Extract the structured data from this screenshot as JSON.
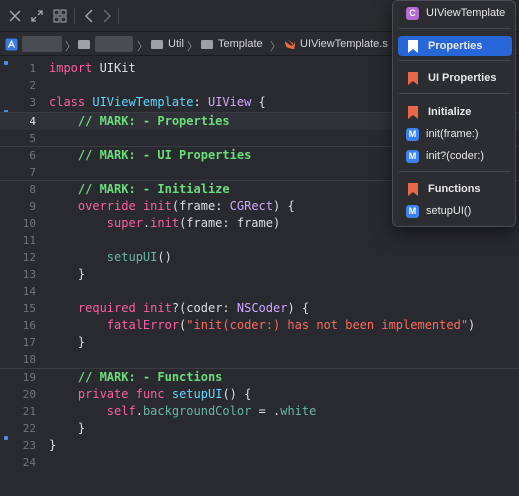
{
  "toolbar": {
    "icons": [
      "close-icon",
      "expand-icon",
      "grid-icon",
      "back-icon",
      "forward-icon"
    ]
  },
  "jumpbar": {
    "crumb_3": "Util",
    "crumb_4": "Template",
    "crumb_5": "UIViewTemplate.s"
  },
  "editor": {
    "line_numbers": [
      "1",
      "2",
      "3",
      "4",
      "5",
      "6",
      "7",
      "8",
      "9",
      "10",
      "11",
      "12",
      "13",
      "14",
      "15",
      "16",
      "17",
      "18",
      "19",
      "20",
      "21",
      "22",
      "23",
      "24"
    ],
    "current_line": "4",
    "mark_properties": "// MARK: - Properties",
    "mark_ui_properties": "// MARK: - UI Properties",
    "mark_initialize": "// MARK: - Initialize",
    "mark_functions": "// MARK: - Functions",
    "fatal_error_message": "\"init(coder:) has not been implemented\"",
    "class_name": "UIViewTemplate",
    "superclass": "UIView",
    "colors": {
      "keyword": "#fc5fa3",
      "mark": "#6bdc7a",
      "string": "#fc6a5d",
      "type": "#d0a8ff"
    }
  },
  "popup": {
    "header": "UIViewTemplate",
    "items": [
      {
        "label": "Properties",
        "kind": "mark",
        "selected": true
      },
      {
        "label": "UI Properties",
        "kind": "mark"
      },
      {
        "label": "Initialize",
        "kind": "mark"
      },
      {
        "label": "init(frame:)",
        "kind": "method"
      },
      {
        "label": "init?(coder:)",
        "kind": "method"
      },
      {
        "label": "Functions",
        "kind": "mark"
      },
      {
        "label": "setupUI()",
        "kind": "method"
      }
    ],
    "selected_color": "#2766d6"
  }
}
